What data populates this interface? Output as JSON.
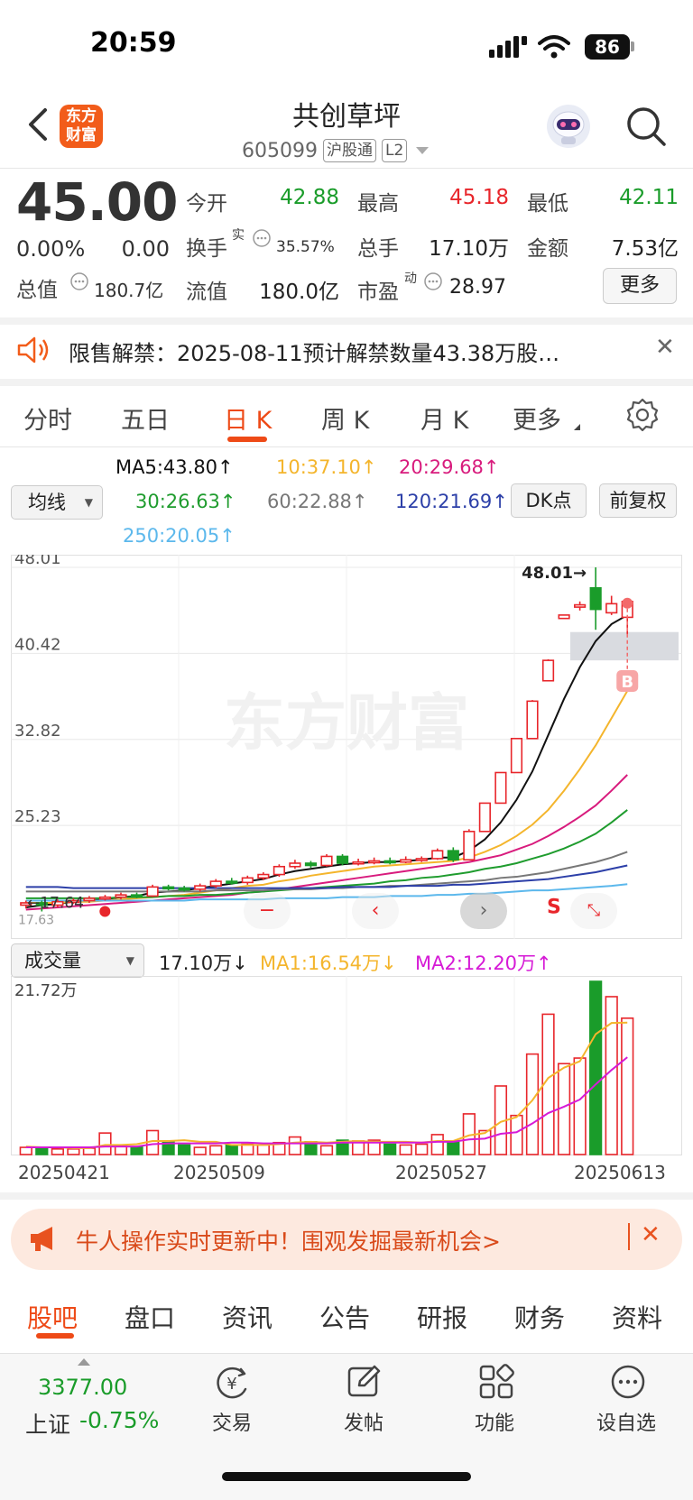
{
  "status_bar": {
    "time": "20:59",
    "battery": "86"
  },
  "header": {
    "logo_line1": "东方",
    "logo_line2": "财富",
    "stock_name": "共创草坪",
    "stock_code": "605099",
    "tag_exchange": "沪股通",
    "tag_level": "L2"
  },
  "quote": {
    "price": "45.00",
    "change_pct": "0.00%",
    "change_amt": "0.00",
    "open_label": "今开",
    "open": "42.88",
    "high_label": "最高",
    "high": "45.18",
    "low_label": "最低",
    "low": "42.11",
    "turnover_label": "换手",
    "turnover_sup": "实",
    "turnover": "35.57%",
    "volume_label": "总手",
    "volume": "17.10万",
    "amount_label": "金额",
    "amount": "7.53亿",
    "mktcap_label": "总值",
    "mktcap": "180.7亿",
    "float_label": "流值",
    "float": "180.0亿",
    "pe_label": "市盈",
    "pe_sup": "动",
    "pe": "28.97",
    "more_button": "更多"
  },
  "notice": {
    "text": "限售解禁：2025-08-11预计解禁数量43.38万股…"
  },
  "chart_tabs": [
    "分时",
    "五日",
    "日 K",
    "周 K",
    "月 K",
    "更多"
  ],
  "ma_panel": {
    "selector": "均线",
    "ma5": "MA5:43.80↑",
    "ma10": "10:37.10↑",
    "ma20": "20:29.68↑",
    "ma30": "30:26.63↑",
    "ma60": "60:22.88↑",
    "ma120": "120:21.69↑",
    "ma250": "250:20.05↑",
    "dk_button": "DK点",
    "adjust_button": "前复权"
  },
  "colors": {
    "accent": "#ee4a17",
    "up": "#e8262b",
    "down": "#1a9c2a",
    "ma5": "#111111",
    "ma10": "#f4b52c",
    "ma20": "#d81b7d",
    "ma30": "#1f9c2e",
    "ma60": "#777777",
    "ma120": "#2c3fa8",
    "ma250": "#5cb8ec"
  },
  "chart_data": {
    "type": "candlestick",
    "y_ticks": [
      "48.01",
      "40.42",
      "32.82",
      "25.23"
    ],
    "max_label": "48.01→",
    "min_label": "←17.64",
    "left_cut_label": "17.63",
    "buy_marker": "B",
    "sell_marker": "S",
    "x_labels": [
      "20250421",
      "20250509",
      "20250527",
      "20250613"
    ],
    "ylim": [
      17.6,
      48.01
    ],
    "candles": [
      {
        "o": 18.2,
        "c": 18.4,
        "h": 18.6,
        "l": 17.9
      },
      {
        "o": 18.4,
        "c": 18.2,
        "h": 18.6,
        "l": 17.64
      },
      {
        "o": 18.2,
        "c": 18.5,
        "h": 18.7,
        "l": 18.0
      },
      {
        "o": 18.5,
        "c": 18.6,
        "h": 18.8,
        "l": 18.3
      },
      {
        "o": 18.6,
        "c": 18.8,
        "h": 19.0,
        "l": 18.4
      },
      {
        "o": 18.8,
        "c": 18.9,
        "h": 19.1,
        "l": 18.6
      },
      {
        "o": 18.9,
        "c": 19.1,
        "h": 19.3,
        "l": 18.7
      },
      {
        "o": 19.1,
        "c": 19.0,
        "h": 19.3,
        "l": 18.8
      },
      {
        "o": 19.0,
        "c": 19.8,
        "h": 20.0,
        "l": 18.9
      },
      {
        "o": 19.8,
        "c": 19.7,
        "h": 20.0,
        "l": 19.5
      },
      {
        "o": 19.7,
        "c": 19.6,
        "h": 19.9,
        "l": 19.4
      },
      {
        "o": 19.6,
        "c": 19.9,
        "h": 20.1,
        "l": 19.4
      },
      {
        "o": 19.9,
        "c": 20.3,
        "h": 20.5,
        "l": 19.7
      },
      {
        "o": 20.3,
        "c": 20.2,
        "h": 20.6,
        "l": 20.0
      },
      {
        "o": 20.2,
        "c": 20.6,
        "h": 20.8,
        "l": 20.0
      },
      {
        "o": 20.6,
        "c": 20.9,
        "h": 21.1,
        "l": 20.4
      },
      {
        "o": 20.9,
        "c": 21.6,
        "h": 21.8,
        "l": 20.7
      },
      {
        "o": 21.6,
        "c": 21.9,
        "h": 22.2,
        "l": 21.4
      },
      {
        "o": 21.9,
        "c": 21.7,
        "h": 22.1,
        "l": 21.5
      },
      {
        "o": 21.7,
        "c": 22.5,
        "h": 22.7,
        "l": 21.6
      },
      {
        "o": 22.5,
        "c": 21.9,
        "h": 22.7,
        "l": 21.7
      },
      {
        "o": 21.9,
        "c": 22.0,
        "h": 22.3,
        "l": 21.7
      },
      {
        "o": 22.0,
        "c": 22.1,
        "h": 22.4,
        "l": 21.8
      },
      {
        "o": 22.1,
        "c": 22.0,
        "h": 22.4,
        "l": 21.8
      },
      {
        "o": 22.0,
        "c": 22.2,
        "h": 22.5,
        "l": 21.9
      },
      {
        "o": 22.2,
        "c": 22.3,
        "h": 22.5,
        "l": 22.0
      },
      {
        "o": 22.3,
        "c": 23.0,
        "h": 23.2,
        "l": 22.2
      },
      {
        "o": 23.0,
        "c": 22.2,
        "h": 23.3,
        "l": 22.0
      },
      {
        "o": 22.2,
        "c": 24.7,
        "h": 24.9,
        "l": 22.2
      },
      {
        "o": 24.7,
        "c": 27.2,
        "h": 27.2,
        "l": 24.7
      },
      {
        "o": 27.2,
        "c": 29.9,
        "h": 29.9,
        "l": 27.2
      },
      {
        "o": 29.9,
        "c": 32.9,
        "h": 32.9,
        "l": 29.9
      },
      {
        "o": 32.9,
        "c": 36.2,
        "h": 36.3,
        "l": 32.9
      },
      {
        "o": 38.0,
        "c": 39.8,
        "h": 39.9,
        "l": 38.0
      },
      {
        "o": 43.5,
        "c": 43.8,
        "h": 43.8,
        "l": 43.5
      },
      {
        "o": 44.5,
        "c": 44.7,
        "h": 45.0,
        "l": 44.2
      },
      {
        "o": 46.2,
        "c": 44.3,
        "h": 48.01,
        "l": 42.5
      },
      {
        "o": 44.0,
        "c": 44.8,
        "h": 45.5,
        "l": 43.8
      },
      {
        "o": 43.6,
        "c": 45.0,
        "h": 45.18,
        "l": 42.11
      }
    ],
    "ma_series": {
      "ma5": [
        18.0,
        18.2,
        18.3,
        18.5,
        18.6,
        18.7,
        18.9,
        19.0,
        19.3,
        19.4,
        19.5,
        19.7,
        19.9,
        20.1,
        20.3,
        20.5,
        20.9,
        21.2,
        21.4,
        21.6,
        21.8,
        21.9,
        22.0,
        22.0,
        22.1,
        22.2,
        22.4,
        22.4,
        23.0,
        24.0,
        25.5,
        27.5,
        30.0,
        33.2,
        36.4,
        39.2,
        41.5,
        43.0,
        43.8
      ],
      "ma10": [
        18.4,
        18.4,
        18.4,
        18.5,
        18.5,
        18.6,
        18.7,
        18.8,
        18.9,
        19.0,
        19.1,
        19.3,
        19.5,
        19.7,
        19.9,
        20.0,
        20.3,
        20.5,
        20.8,
        21.0,
        21.2,
        21.4,
        21.6,
        21.7,
        21.8,
        21.9,
        22.0,
        22.1,
        22.4,
        22.9,
        23.5,
        24.3,
        25.3,
        26.6,
        28.3,
        30.2,
        32.3,
        34.7,
        37.1
      ],
      "ma20": [
        17.8,
        17.9,
        18.0,
        18.1,
        18.2,
        18.3,
        18.4,
        18.5,
        18.6,
        18.7,
        18.8,
        18.9,
        19.0,
        19.1,
        19.3,
        19.4,
        19.6,
        19.8,
        20.0,
        20.2,
        20.4,
        20.6,
        20.8,
        21.0,
        21.2,
        21.4,
        21.6,
        21.8,
        22.0,
        22.3,
        22.6,
        23.1,
        23.6,
        24.3,
        25.1,
        26.0,
        27.0,
        28.3,
        29.7
      ],
      "ma30": [
        18.8,
        18.8,
        18.8,
        18.8,
        18.8,
        18.8,
        18.9,
        18.9,
        18.9,
        19.0,
        19.0,
        19.1,
        19.1,
        19.2,
        19.3,
        19.4,
        19.5,
        19.6,
        19.7,
        19.8,
        19.9,
        20.0,
        20.1,
        20.3,
        20.4,
        20.6,
        20.7,
        20.9,
        21.1,
        21.4,
        21.6,
        21.9,
        22.3,
        22.7,
        23.2,
        23.8,
        24.5,
        25.5,
        26.6
      ],
      "ma60": [
        19.4,
        19.4,
        19.4,
        19.4,
        19.4,
        19.4,
        19.4,
        19.4,
        19.4,
        19.4,
        19.4,
        19.4,
        19.5,
        19.5,
        19.5,
        19.5,
        19.6,
        19.6,
        19.6,
        19.7,
        19.7,
        19.8,
        19.8,
        19.9,
        19.9,
        20.0,
        20.1,
        20.2,
        20.3,
        20.4,
        20.6,
        20.7,
        20.9,
        21.1,
        21.4,
        21.7,
        22.0,
        22.4,
        22.9
      ],
      "ma120": [
        19.8,
        19.8,
        19.8,
        19.7,
        19.7,
        19.7,
        19.7,
        19.7,
        19.7,
        19.7,
        19.7,
        19.7,
        19.7,
        19.7,
        19.7,
        19.7,
        19.7,
        19.7,
        19.7,
        19.7,
        19.8,
        19.8,
        19.8,
        19.8,
        19.9,
        19.9,
        19.9,
        20.0,
        20.0,
        20.1,
        20.2,
        20.3,
        20.4,
        20.5,
        20.7,
        20.9,
        21.1,
        21.4,
        21.7
      ],
      "ma250": [
        18.6,
        18.6,
        18.6,
        18.6,
        18.6,
        18.6,
        18.6,
        18.6,
        18.6,
        18.6,
        18.6,
        18.7,
        18.7,
        18.7,
        18.7,
        18.7,
        18.8,
        18.8,
        18.8,
        18.8,
        18.9,
        18.9,
        18.9,
        19.0,
        19.0,
        19.0,
        19.1,
        19.1,
        19.2,
        19.2,
        19.3,
        19.4,
        19.5,
        19.5,
        19.6,
        19.7,
        19.8,
        19.9,
        20.05
      ]
    },
    "volume": {
      "selector": "成交量",
      "current": "17.10万↓",
      "ma1": "MA1:16.54万↓",
      "ma2": "MA2:12.20万↑",
      "max_label": "21.72万",
      "ymax": 21.72,
      "values": [
        0.9,
        0.8,
        0.7,
        0.7,
        0.8,
        2.7,
        1.1,
        1.0,
        3.0,
        1.6,
        1.2,
        0.9,
        1.1,
        1.2,
        1.3,
        1.2,
        1.5,
        2.2,
        1.6,
        1.1,
        1.8,
        1.7,
        1.8,
        1.3,
        1.2,
        1.3,
        2.5,
        1.7,
        5.1,
        3.0,
        8.6,
        4.9,
        12.6,
        17.6,
        11.4,
        12.1,
        21.72,
        19.8,
        17.1
      ],
      "ma1_series": [
        1.0,
        0.9,
        0.9,
        0.8,
        0.8,
        1.2,
        1.2,
        1.3,
        1.7,
        1.7,
        1.8,
        1.6,
        1.6,
        1.2,
        1.2,
        1.2,
        1.3,
        1.5,
        1.6,
        1.5,
        1.6,
        1.7,
        1.6,
        1.6,
        1.6,
        1.5,
        1.7,
        1.7,
        2.4,
        2.7,
        4.1,
        4.7,
        6.8,
        9.6,
        10.9,
        11.7,
        15.1,
        16.5,
        16.54
      ],
      "ma2_series": [
        0.9,
        0.9,
        0.9,
        0.9,
        0.9,
        1.0,
        1.0,
        1.0,
        1.3,
        1.4,
        1.4,
        1.4,
        1.4,
        1.5,
        1.5,
        1.4,
        1.4,
        1.4,
        1.4,
        1.4,
        1.5,
        1.5,
        1.5,
        1.5,
        1.5,
        1.5,
        1.6,
        1.6,
        1.9,
        2.0,
        2.6,
        2.8,
        3.9,
        5.2,
        6.0,
        6.9,
        8.8,
        10.6,
        12.2
      ]
    }
  },
  "banner": {
    "text": "牛人操作实时更新中！围观发掘最新机会>"
  },
  "bottom_tabs": [
    "股吧",
    "盘口",
    "资讯",
    "公告",
    "研报",
    "财务",
    "资料"
  ],
  "bottom_nav": {
    "index_value": "3377.00",
    "index_name": "上证",
    "index_change": "-0.75%",
    "trade": "交易",
    "trade_icon_char": "¥",
    "post": "发帖",
    "function": "功能",
    "watchlist": "设自选"
  },
  "watermark": "东方财富"
}
